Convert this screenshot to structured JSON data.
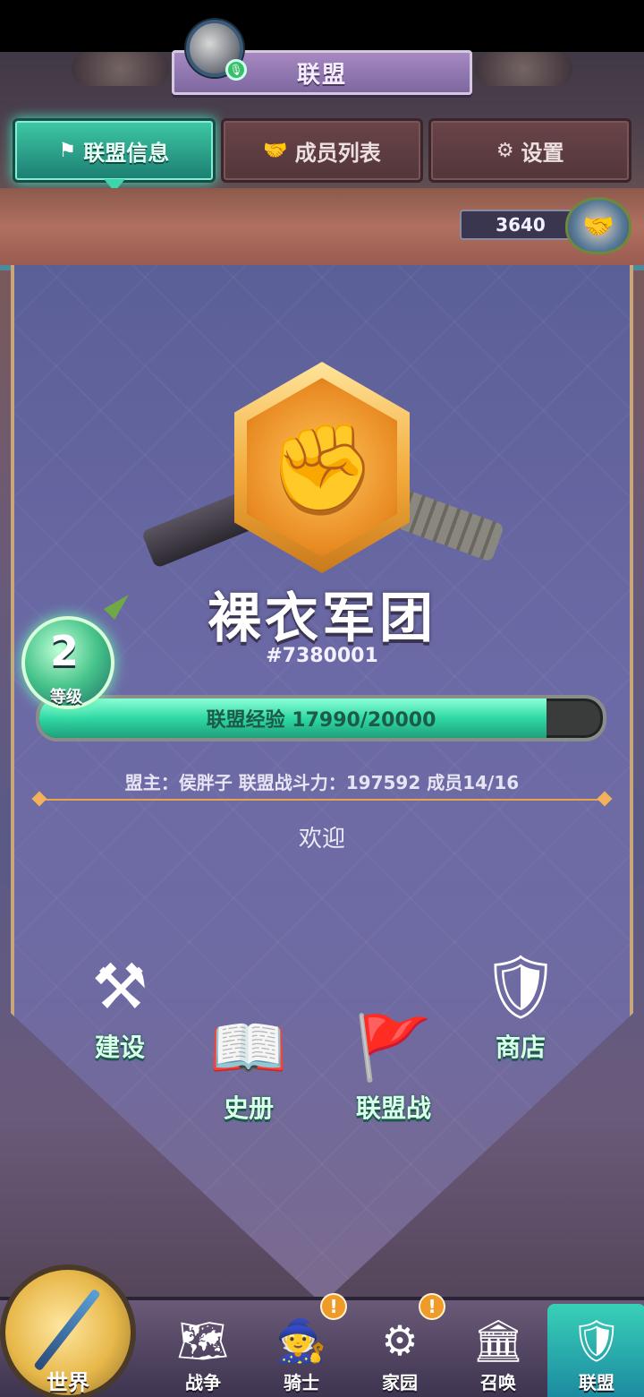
{
  "header": {
    "title": "联盟",
    "avatar_badge_icon": "mic-icon"
  },
  "tabs": [
    {
      "label": "联盟信息",
      "icon": "flag-icon",
      "active": true
    },
    {
      "label": "成员列表",
      "icon": "handshake-icon",
      "active": false
    },
    {
      "label": "设置",
      "icon": "gear-icon",
      "active": false
    }
  ],
  "power": {
    "value": "3640",
    "icon": "alliance-emblem-icon"
  },
  "guild": {
    "emblem_icon": "fist-icon",
    "name": "裸衣军团",
    "id": "#7380001"
  },
  "level": {
    "value": "2",
    "tag": "等级"
  },
  "experience": {
    "label": "联盟经验 17990/20000",
    "current": 17990,
    "max": 20000
  },
  "info_line": "盟主：侯胖子 联盟战斗力：197592 成员14/16",
  "welcome": "欢迎",
  "features": [
    {
      "label": "建设",
      "icon": "crossed-saws-icon"
    },
    {
      "label": "史册",
      "icon": "book-icon"
    },
    {
      "label": "联盟战",
      "icon": "red-flag-icon"
    },
    {
      "label": "商店",
      "icon": "shop-icon"
    }
  ],
  "bottom_nav": {
    "world": "世界",
    "items": [
      {
        "label": "战争",
        "icon": "map-icon",
        "alert": false
      },
      {
        "label": "骑士",
        "icon": "knight-icon",
        "alert": true
      },
      {
        "label": "家园",
        "icon": "home-gear-icon",
        "alert": true
      },
      {
        "label": "召唤",
        "icon": "summon-icon",
        "alert": false
      },
      {
        "label": "联盟",
        "icon": "alliance-icon",
        "alert": false,
        "active": true
      }
    ],
    "alert_glyph": "!"
  },
  "colors": {
    "active_tab": "#3ec9a4",
    "exp_fill": "#2fd8a4",
    "label_green": "#d8ffe8",
    "divider": "#e8a44c"
  }
}
